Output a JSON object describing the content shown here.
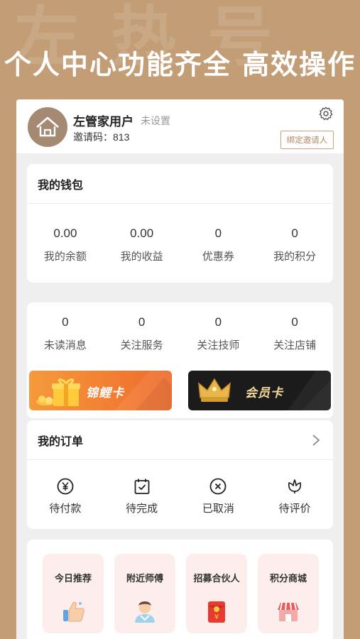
{
  "headline": "个人中心功能齐全 高效操作",
  "profile": {
    "username": "左管家用户",
    "unset_label": "未设置",
    "invite_code": "邀请码：813",
    "bind_button": "绑定邀请人"
  },
  "wallet": {
    "title": "我的钱包",
    "items": [
      {
        "value": "0.00",
        "label": "我的余额"
      },
      {
        "value": "0.00",
        "label": "我的收益"
      },
      {
        "value": "0",
        "label": "优惠券"
      },
      {
        "value": "0",
        "label": "我的积分"
      }
    ]
  },
  "follows": {
    "items": [
      {
        "value": "0",
        "label": "未读消息"
      },
      {
        "value": "0",
        "label": "关注服务"
      },
      {
        "value": "0",
        "label": "关注技师"
      },
      {
        "value": "0",
        "label": "关注店铺"
      }
    ]
  },
  "promos": {
    "koi_card": "锦鲤卡",
    "member_card": "会员卡"
  },
  "orders": {
    "title": "我的订单",
    "items": [
      {
        "label": "待付款",
        "icon": "yen-circle-icon"
      },
      {
        "label": "待完成",
        "icon": "calendar-check-icon"
      },
      {
        "label": "已取消",
        "icon": "cancel-circle-icon"
      },
      {
        "label": "待评价",
        "icon": "flower-icon"
      }
    ]
  },
  "services": {
    "items": [
      {
        "label": "今日推荐",
        "icon": "thumbs-up-icon"
      },
      {
        "label": "附近师傅",
        "icon": "technician-icon"
      },
      {
        "label": "招募合伙人",
        "icon": "red-envelope-icon"
      },
      {
        "label": "积分商城",
        "icon": "shop-icon"
      }
    ]
  },
  "colors": {
    "background": "#c29d76",
    "accent": "#b08a66",
    "koi_card": "#f07a36",
    "member_card": "#1c1c1c"
  }
}
